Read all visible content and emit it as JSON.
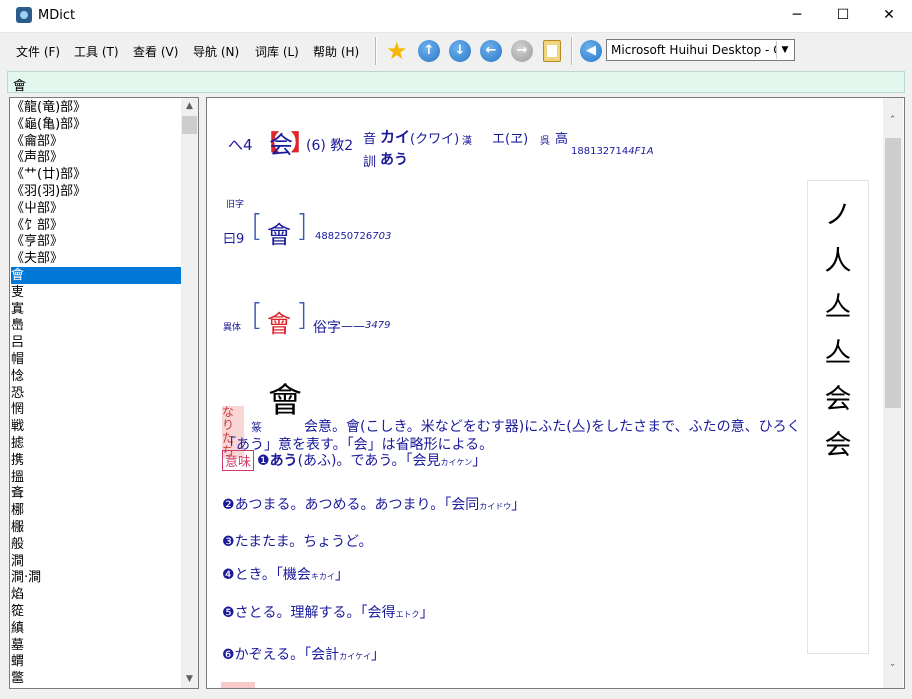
{
  "window": {
    "title": "MDict"
  },
  "menu": [
    "文件 (F)",
    "工具 (T)",
    "查看 (V)",
    "导航 (N)",
    "词库 (L)",
    "帮助 (H)"
  ],
  "toolbar": {
    "dictionary": "Microsoft Huihui Desktop - C"
  },
  "search": {
    "value": "會"
  },
  "word_list": {
    "selected_index": 10,
    "items": [
      "《龍(竜)部》",
      "《龜(亀)部》",
      "《龠部》",
      "《声部》",
      "《艹(廿)部》",
      "《羽(羽)部》",
      "《屮部》",
      "《饣部》",
      "《亨部》",
      "《夫部》",
      "會",
      "叓",
      "寘",
      "㠀",
      "吕",
      "帽",
      "惗",
      "恐",
      "惘",
      "戦",
      "摅",
      "携",
      "搵",
      "斊",
      "梛",
      "棴",
      "般",
      "澗",
      "澗·澗",
      "焰",
      "篵",
      "縝",
      "墓",
      "蝟",
      "鄨"
    ]
  },
  "entry": {
    "radical_prefix": "へ4",
    "headword": "会",
    "grade": "(6) 教2",
    "on_label": "音",
    "on_kan": "カイ",
    "on_kan_alt": "(クワイ)",
    "kan_tag": "漢",
    "on_go": "エ(ヱ)",
    "go_tag": "呉",
    "kou_tag": "高",
    "kun_label": "訓",
    "kun_reading": "あう",
    "code1": "188132714",
    "code1_tail": "4F1A",
    "old_label": "旧字",
    "old_radical": "曰9",
    "old_char": "會",
    "code2": "488250726",
    "code2_tail": "703",
    "var_label": "異体",
    "var_char": "會",
    "var_desc": "俗字",
    "var_num": "3479",
    "origin_tag": "なりたち",
    "seal_label": "篆",
    "seal_glyph": "會",
    "origin_text_1": "会意。會(こしき。米などをむす器)にふた(亼)をしたさまで、ふたの意、ひろく",
    "origin_text_2": "「あう」意を表す。「会」は省略形による。",
    "meaning_tag": "意味",
    "meanings": [
      {
        "num": "❶",
        "text": "あう(あふ)。であう。「会見",
        "reading": "カイケン",
        "close": "」",
        "bold": "あう"
      },
      {
        "num": "❷",
        "text": "あつまる。あつめる。あつまり。「会同",
        "reading": "カイドウ",
        "close": "」"
      },
      {
        "num": "❸",
        "text": "たまたま。ちょうど。",
        "reading": "",
        "close": ""
      },
      {
        "num": "❹",
        "text": "とき。「機会",
        "reading": "キカイ",
        "close": "」"
      },
      {
        "num": "❺",
        "text": "さとる。理解する。「会得",
        "reading": "エトク",
        "close": "」"
      },
      {
        "num": "❻",
        "text": "かぞえる。「会計",
        "reading": "カイケイ",
        "close": "」"
      }
    ],
    "strokes": [
      "ノ",
      "人",
      "亼",
      "亼",
      "会",
      "会"
    ]
  }
}
